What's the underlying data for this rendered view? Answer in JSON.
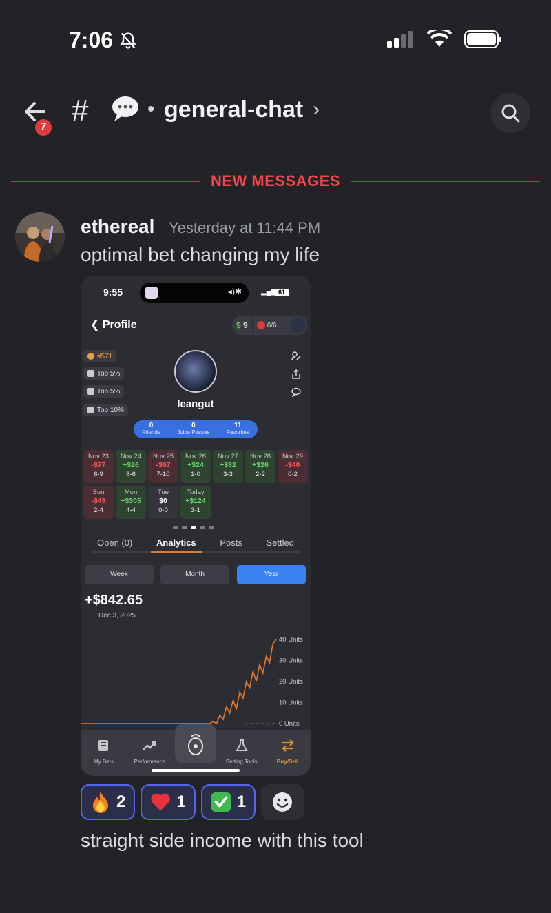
{
  "status_bar": {
    "time": "7:06"
  },
  "header": {
    "back_badge_count": "7",
    "hash": "#",
    "separator": "•",
    "channel_name": "general-chat",
    "chevron": "›",
    "icons": {
      "back": "arrow-left-icon",
      "speech": "speech-bubble-icon",
      "search": "search-icon",
      "bell_off": "bell-slash-icon"
    }
  },
  "divider": {
    "label": "NEW MESSAGES"
  },
  "message": {
    "author": "ethereal",
    "timestamp": "Yesterday at 11:44 PM",
    "text": "optimal bet changing my life",
    "followup": "straight side income with this tool"
  },
  "screenshot": {
    "time": "9:55",
    "battery": "61",
    "title": "Profile",
    "wallet": {
      "cash_symbol": "$",
      "cash_value": "9",
      "alerts": "6/6"
    },
    "badges": [
      {
        "label": "#571"
      },
      {
        "label": "Top 5%"
      },
      {
        "label": "Top 5%"
      },
      {
        "label": "Top 10%"
      }
    ],
    "username": "leangut",
    "stats": [
      {
        "value": "0",
        "label": "Friends"
      },
      {
        "value": "0",
        "label": "Juice Passes"
      },
      {
        "value": "11",
        "label": "Favorites"
      }
    ],
    "days": [
      {
        "date": "Nov 23",
        "amount": "-$77",
        "record": "6-9",
        "kind": "neg"
      },
      {
        "date": "Nov 24",
        "amount": "+$26",
        "record": "8-6",
        "kind": "pos"
      },
      {
        "date": "Nov 25",
        "amount": "-$67",
        "record": "7-10",
        "kind": "neg"
      },
      {
        "date": "Nov 26",
        "amount": "+$24",
        "record": "1-0",
        "kind": "pos"
      },
      {
        "date": "Nov 27",
        "amount": "+$32",
        "record": "3-3",
        "kind": "pos"
      },
      {
        "date": "Nov 28",
        "amount": "+$26",
        "record": "2-2",
        "kind": "pos"
      },
      {
        "date": "Nov 29",
        "amount": "-$40",
        "record": "0-2",
        "kind": "neg"
      },
      {
        "date": "Sun",
        "amount": "-$49",
        "record": "2-4",
        "kind": "neg"
      },
      {
        "date": "Mon",
        "amount": "+$305",
        "record": "4-4",
        "kind": "pos"
      },
      {
        "date": "Tue",
        "amount": "$0",
        "record": "0-0",
        "kind": "zero"
      },
      {
        "date": "Today",
        "amount": "+$124",
        "record": "3-1",
        "kind": "pos"
      }
    ],
    "tabs": [
      "Open (0)",
      "Analytics",
      "Posts",
      "Settled"
    ],
    "ranges": [
      "Week",
      "Month",
      "Year"
    ],
    "amount": "+$842.65",
    "date": "Dec 3, 2025",
    "nav": [
      "My Bets",
      "Performance",
      "Betting Tools",
      "Buy/Sell"
    ],
    "colors": {
      "positive": "#67d36a",
      "negative": "#ff5a5a",
      "accent": "#e07a2e",
      "blue": "#3b83f0"
    }
  },
  "chart_data": {
    "type": "line",
    "ylabel": "",
    "y_ticks": [
      "40 Units",
      "30 Units",
      "20 Units",
      "10 Units",
      "0 Units"
    ],
    "ylim": [
      0,
      40
    ],
    "series": [
      {
        "values": [
          0,
          0,
          0,
          0,
          0,
          0,
          0,
          0,
          0,
          0,
          0,
          0,
          0,
          0,
          0,
          0,
          0,
          0,
          0,
          0,
          0,
          0,
          0,
          0,
          0,
          0,
          0,
          0,
          0,
          0,
          0,
          0,
          0,
          0,
          0,
          0,
          0,
          0,
          0,
          0,
          1,
          0,
          4,
          2,
          8,
          5,
          11,
          7,
          15,
          12,
          20,
          17,
          25,
          20,
          28,
          24,
          32,
          29,
          38,
          40
        ]
      }
    ]
  },
  "reactions": [
    {
      "emoji": "fire-icon",
      "count": "2"
    },
    {
      "emoji": "heart-icon",
      "count": "1"
    },
    {
      "emoji": "check-mark-icon",
      "count": "1"
    }
  ]
}
